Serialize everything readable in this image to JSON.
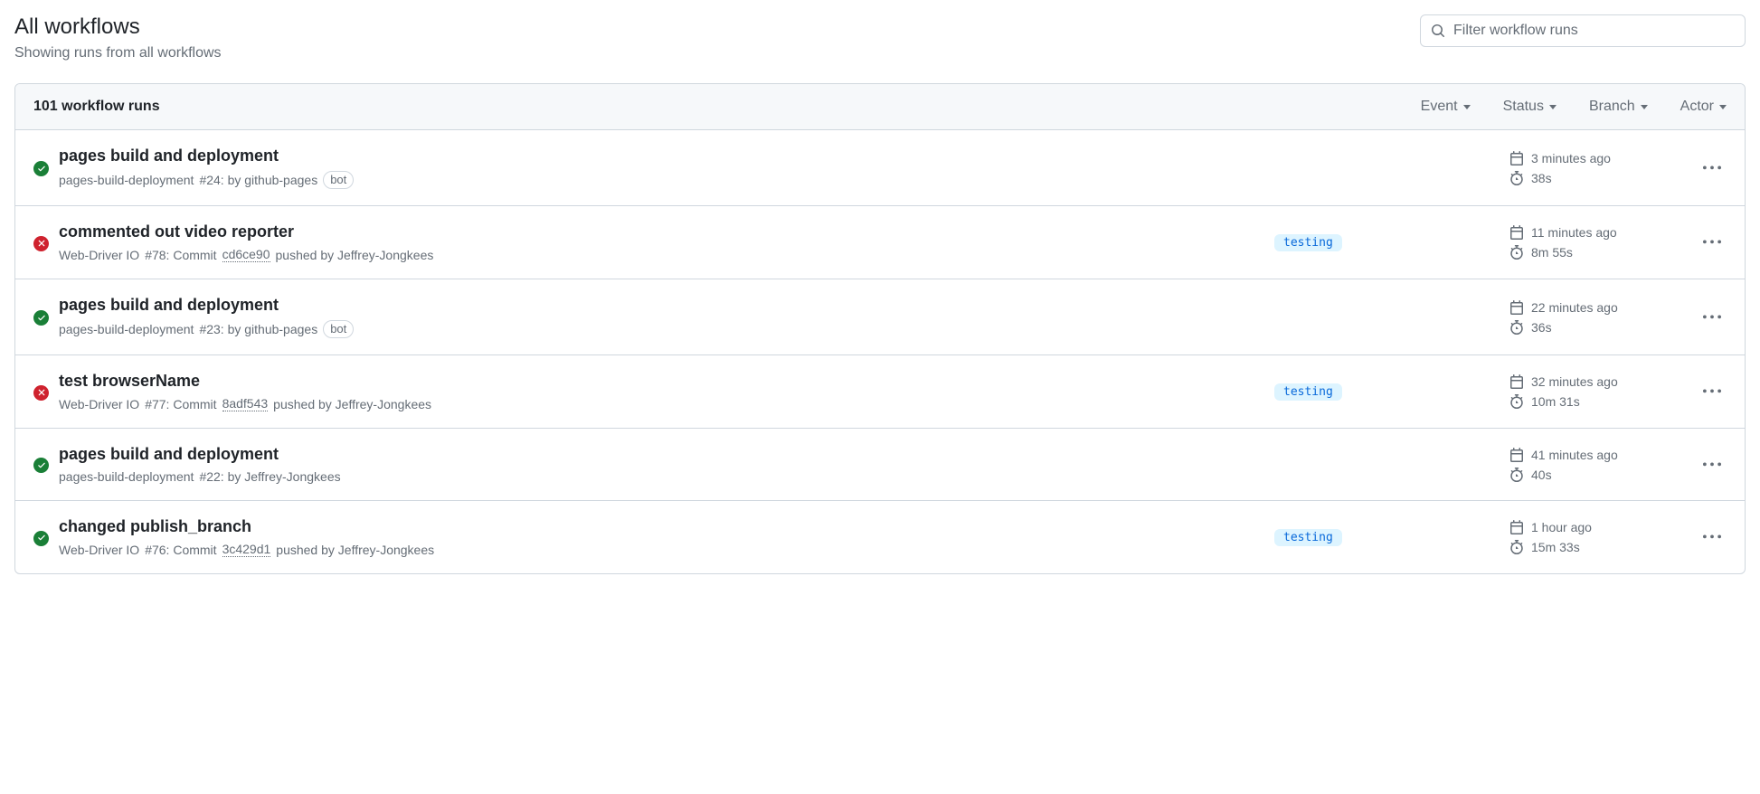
{
  "header": {
    "title": "All workflows",
    "subtitle": "Showing runs from all workflows"
  },
  "search": {
    "placeholder": "Filter workflow runs",
    "value": ""
  },
  "list": {
    "count_label": "101 workflow runs",
    "filters": {
      "event": "Event",
      "status": "Status",
      "branch": "Branch",
      "actor": "Actor"
    }
  },
  "bot_label": "bot",
  "runs": [
    {
      "status": "success",
      "title": "pages build and deployment",
      "workflow": "pages-build-deployment",
      "run_text": "#24: by github-pages",
      "commit": null,
      "commit_suffix": null,
      "is_bot": true,
      "branch": null,
      "time": "3 minutes ago",
      "duration": "38s"
    },
    {
      "status": "failure",
      "title": "commented out video reporter",
      "workflow": "Web-Driver IO",
      "run_text": "#78: Commit ",
      "commit": "cd6ce90",
      "commit_suffix": " pushed by Jeffrey-Jongkees",
      "is_bot": false,
      "branch": "testing",
      "time": "11 minutes ago",
      "duration": "8m 55s"
    },
    {
      "status": "success",
      "title": "pages build and deployment",
      "workflow": "pages-build-deployment",
      "run_text": "#23: by github-pages",
      "commit": null,
      "commit_suffix": null,
      "is_bot": true,
      "branch": null,
      "time": "22 minutes ago",
      "duration": "36s"
    },
    {
      "status": "failure",
      "title": "test browserName",
      "workflow": "Web-Driver IO",
      "run_text": "#77: Commit ",
      "commit": "8adf543",
      "commit_suffix": " pushed by Jeffrey-Jongkees",
      "is_bot": false,
      "branch": "testing",
      "time": "32 minutes ago",
      "duration": "10m 31s"
    },
    {
      "status": "success",
      "title": "pages build and deployment",
      "workflow": "pages-build-deployment",
      "run_text": "#22: by Jeffrey-Jongkees",
      "commit": null,
      "commit_suffix": null,
      "is_bot": false,
      "branch": null,
      "time": "41 minutes ago",
      "duration": "40s"
    },
    {
      "status": "success",
      "title": "changed publish_branch",
      "workflow": "Web-Driver IO",
      "run_text": "#76: Commit ",
      "commit": "3c429d1",
      "commit_suffix": " pushed by Jeffrey-Jongkees",
      "is_bot": false,
      "branch": "testing",
      "time": "1 hour ago",
      "duration": "15m 33s"
    }
  ]
}
